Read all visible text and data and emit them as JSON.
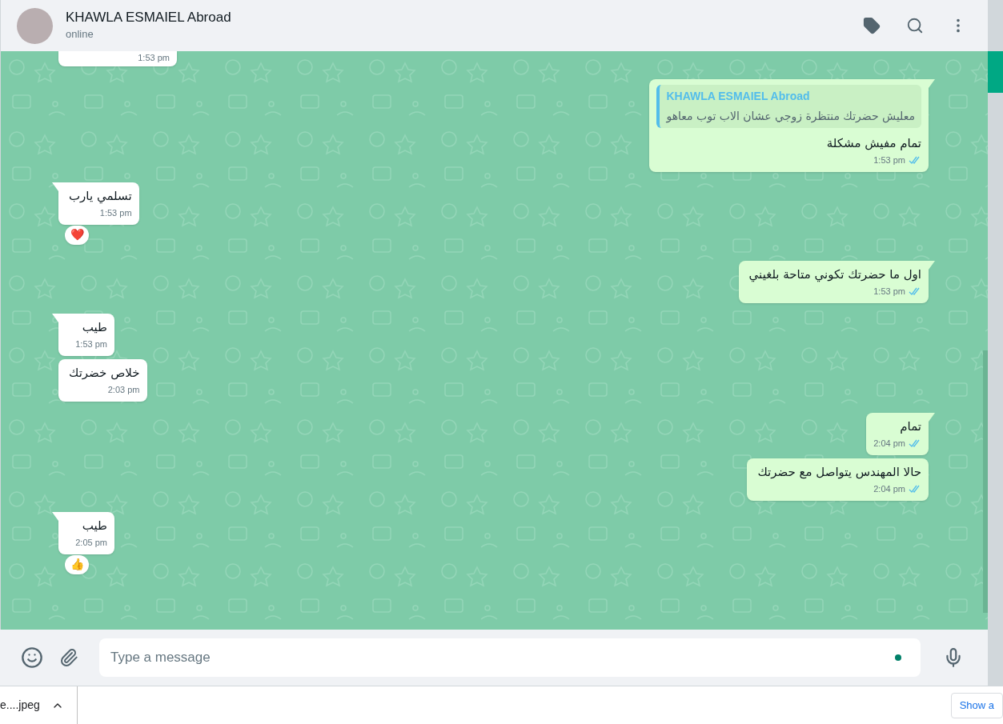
{
  "header": {
    "name": "KHAWLA ESMAIEL Abroad",
    "status": "online"
  },
  "messages": [
    {
      "kind": "incoming",
      "time": "1:53 pm",
      "cut": true
    },
    {
      "kind": "outgoing",
      "quote": {
        "author": "KHAWLA ESMAIEL Abroad",
        "text": "معليش حضرتك منتظرة زوجي عشان الاب توب معاهو"
      },
      "text": "تمام مفيش مشكلة",
      "time": "1:53 pm",
      "read": true,
      "tail": true
    },
    {
      "kind": "incoming",
      "text": "تسلمي يارب",
      "time": "1:53 pm",
      "tail": true,
      "reaction": "❤️"
    },
    {
      "kind": "outgoing",
      "text": "اول ما حضرتك تكوني متاحة بلغيني",
      "time": "1:53 pm",
      "read": true,
      "tail": true
    },
    {
      "kind": "incoming",
      "text": "طيب",
      "time": "1:53 pm",
      "tail": true
    },
    {
      "kind": "incoming",
      "text": "خلاص خضرتك",
      "time": "2:03 pm",
      "tail": false
    },
    {
      "kind": "outgoing",
      "text": "تمام",
      "time": "2:04 pm",
      "read": true,
      "tail": true
    },
    {
      "kind": "outgoing",
      "text": "حالا المهندس يتواصل مع حضرتك",
      "time": "2:04 pm",
      "read": true,
      "tail": false
    },
    {
      "kind": "incoming",
      "text": "طيب",
      "time": "2:05 pm",
      "tail": true,
      "reaction": "👍"
    }
  ],
  "composer": {
    "placeholder": "Type a message"
  },
  "downloads": {
    "file": "e....jpeg",
    "show_all": "Show a"
  }
}
